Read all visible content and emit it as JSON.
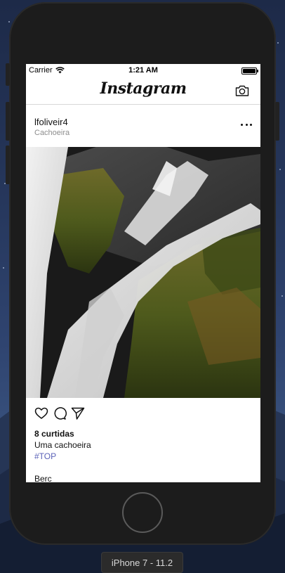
{
  "status_bar": {
    "carrier": "Carrier",
    "time": "1:21 AM"
  },
  "nav": {
    "logo": "Instagram",
    "camera_icon": "camera-icon"
  },
  "post": {
    "username": "lfoliveir4",
    "location": "Cachoeira",
    "more_icon": "ellipsis-icon",
    "image": "waterfall-photo",
    "actions": [
      "heart-icon",
      "comment-icon",
      "share-icon"
    ],
    "likes": "8 curtidas",
    "caption": "Uma cachoeira",
    "hashtag": "#TOP",
    "hashtag_color": "#5b62b8",
    "next_comment": "Berc"
  },
  "simulator": {
    "device_label": "iPhone 7 - 11.2"
  }
}
